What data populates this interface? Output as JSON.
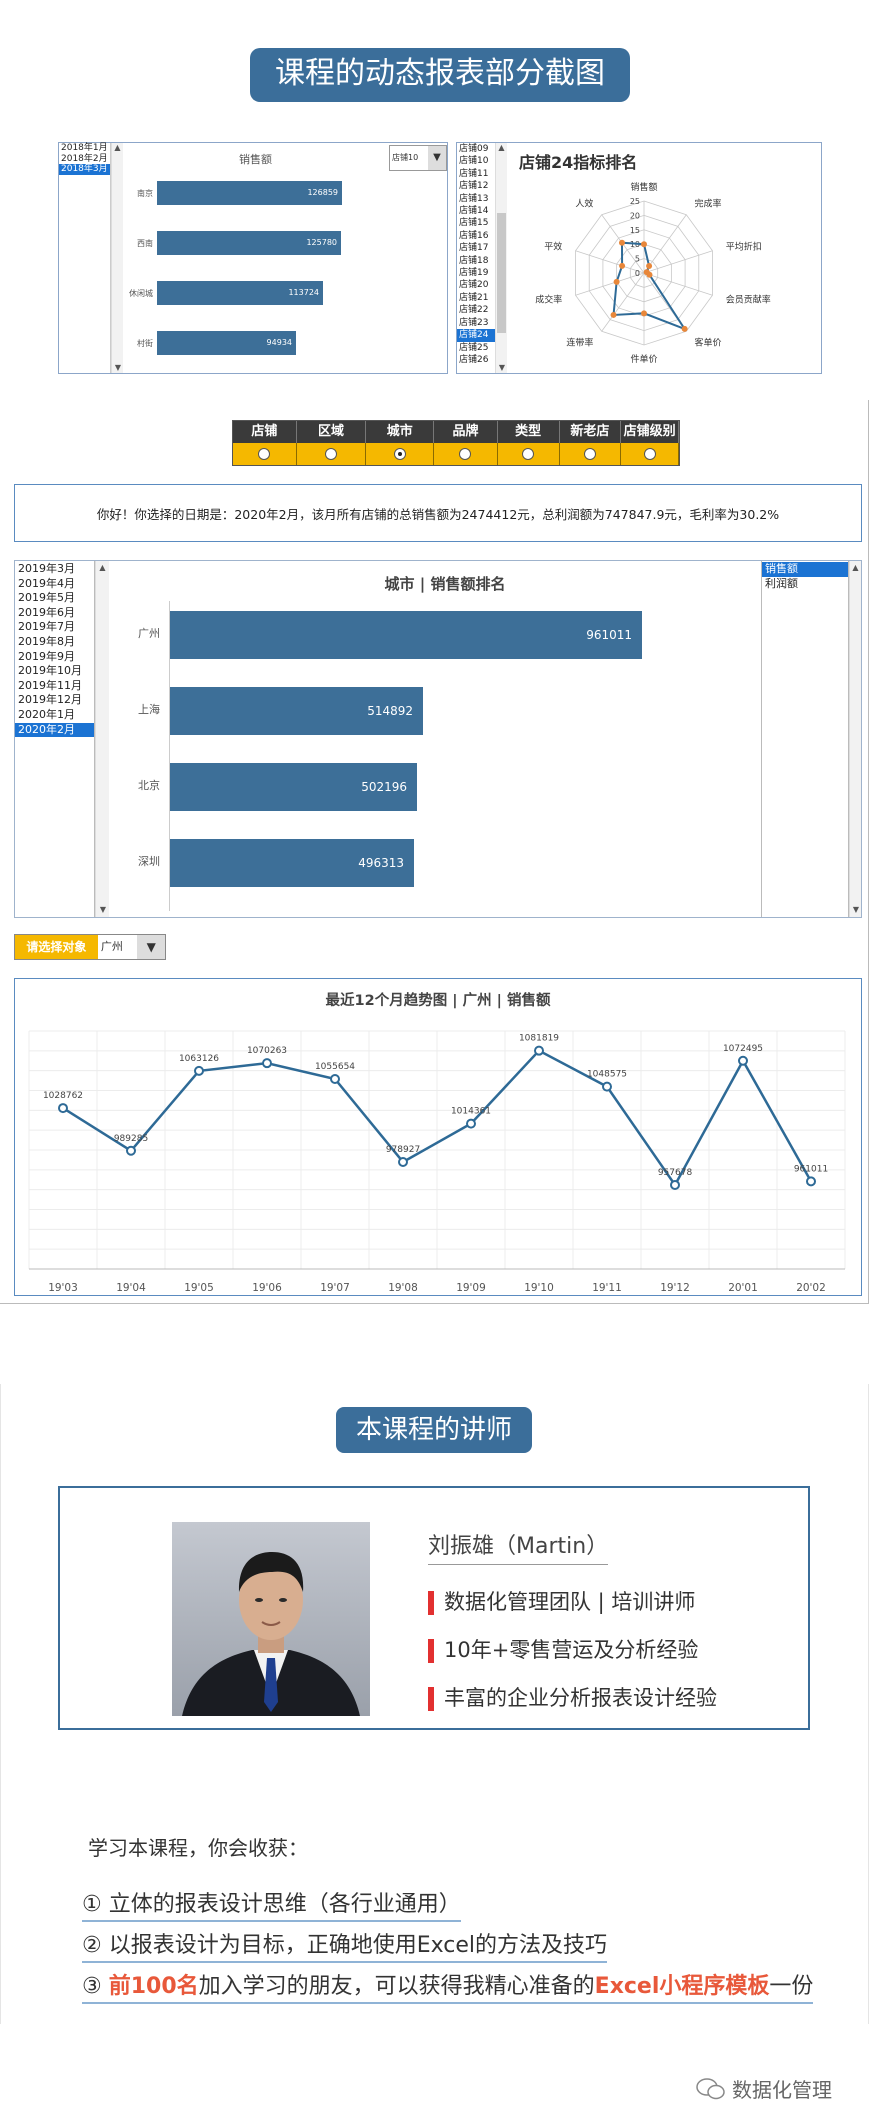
{
  "section1": {
    "title": "课程的动态报表部分截图"
  },
  "mini_bar": {
    "dates": [
      "2018年1月",
      "2018年2月",
      "2018年3月"
    ],
    "selected_index": 2,
    "title": "销售额",
    "dropdown_value": "店铺10",
    "categories": [
      "南京",
      "西南",
      "休闲城",
      "村街"
    ],
    "values": [
      126859,
      125780,
      113724,
      94934
    ]
  },
  "radar": {
    "stores": [
      "店铺09",
      "店铺10",
      "店铺11",
      "店铺12",
      "店铺13",
      "店铺14",
      "店铺15",
      "店铺16",
      "店铺17",
      "店铺18",
      "店铺19",
      "店铺20",
      "店铺21",
      "店铺22",
      "店铺23",
      "店铺24",
      "店铺25",
      "店铺26"
    ],
    "selected_index": 15,
    "title": "店铺24指标排名"
  },
  "chart_data": [
    {
      "type": "radar",
      "title": "店铺24指标排名",
      "axes": [
        "销售额",
        "完成率",
        "平均折扣",
        "会员贡献率",
        "客单价",
        "件单价",
        "连带率",
        "成交率",
        "平效",
        "人效"
      ],
      "ticks": [
        0,
        5,
        10,
        15,
        20,
        25
      ],
      "ylim": [
        0,
        25
      ],
      "values": [
        10,
        3,
        1,
        2,
        24,
        14,
        18,
        10,
        8,
        13
      ]
    },
    {
      "type": "bar",
      "title": "城市 | 销售额排名",
      "categories": [
        "广州",
        "上海",
        "北京",
        "深圳"
      ],
      "values": [
        961011,
        514892,
        502196,
        496313
      ]
    },
    {
      "type": "line",
      "title": "最近12个月趋势图 | 广州 | 销售额",
      "x": [
        "19'03",
        "19'04",
        "19'05",
        "19'06",
        "19'07",
        "19'08",
        "19'09",
        "19'10",
        "19'11",
        "19'12",
        "20'01",
        "20'02"
      ],
      "values": [
        1028762,
        989285,
        1063126,
        1070263,
        1055654,
        978927,
        1014361,
        1081819,
        1048575,
        957678,
        1072495,
        961011
      ],
      "ylim": [
        880000,
        1100000
      ],
      "grid": true
    }
  ],
  "filter": {
    "headers": [
      "店铺",
      "区域",
      "城市",
      "品牌",
      "类型",
      "新老店",
      "店铺级别"
    ],
    "selected_index": 2
  },
  "info": {
    "text": "你好！你选择的日期是：2020年2月，该月所有店铺的总销售额为2474412元，总利润额为747847.9元，毛利率为30.2%"
  },
  "dates": {
    "items": [
      "2019年3月",
      "2019年4月",
      "2019年5月",
      "2019年6月",
      "2019年7月",
      "2019年8月",
      "2019年9月",
      "2019年10月",
      "2019年11月",
      "2019年12月",
      "2020年1月",
      "2020年2月"
    ],
    "selected_index": 11
  },
  "metrics": {
    "items": [
      "销售额",
      "利润额"
    ],
    "selected_index": 0
  },
  "selector": {
    "label": "请选择对象",
    "value": "广州"
  },
  "section2": {
    "title": "本课程的讲师"
  },
  "teacher": {
    "name": "刘振雄（Martin）",
    "points": [
      "数据化管理团队 | 培训讲师",
      "10年+零售营运及分析经验",
      "丰富的企业分析报表设计经验"
    ]
  },
  "gains": {
    "heading": "学习本课程，你会收获：",
    "item1": "① 立体的报表设计思维（各行业通用）",
    "item2": "② 以报表设计为目标，正确地使用Excel的方法及技巧",
    "item3": {
      "prefix": "③ ",
      "h1": "前100名",
      "mid": "加入学习的朋友，可以获得我精心准备的",
      "h2": "Excel小程序模板",
      "suffix": "一份"
    }
  },
  "footer": {
    "brand": "数据化管理"
  },
  "colors": {
    "accent": "#3b6e9a",
    "bar": "#3d6f98",
    "line": "#2e6a96",
    "marker": "#e8873a",
    "highlight": "#e8583a",
    "filter_bg": "#f5b800"
  }
}
